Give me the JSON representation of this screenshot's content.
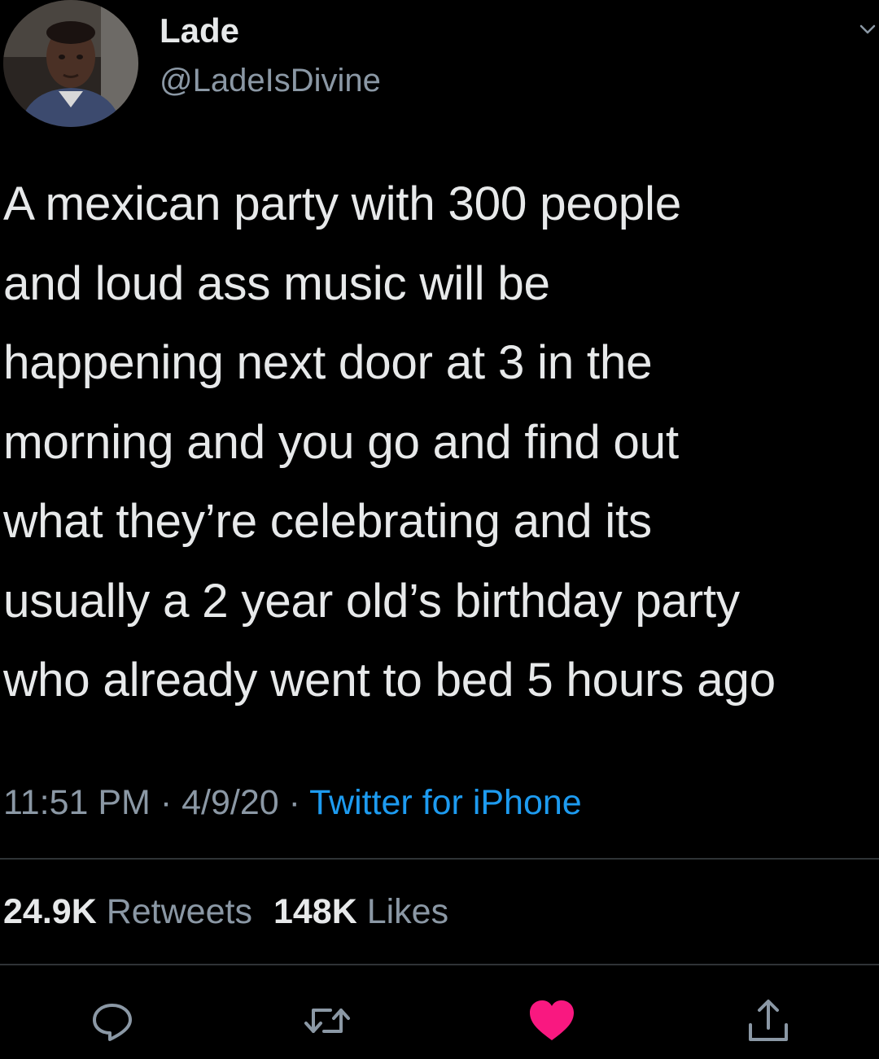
{
  "tweet": {
    "author": {
      "display_name": "Lade",
      "handle": "@LadeIsDivine",
      "avatar_icon": "profile-photo"
    },
    "text": "A mexican party with 300 people\nand loud ass music will be\nhappening next door at 3 in the\nmorning and you go and find out\nwhat they’re celebrating and its\nusually a 2 year old’s birthday party\nwho already went to bed 5 hours ago",
    "time": "11:51 PM",
    "separator": "·",
    "date": "4/9/20",
    "source": "Twitter for iPhone",
    "stats": {
      "retweets_count": "24.9K",
      "retweets_label": "Retweets",
      "likes_count": "148K",
      "likes_label": "Likes"
    },
    "actions": {
      "reply_icon": "reply-icon",
      "retweet_icon": "retweet-icon",
      "like_icon": "heart-icon",
      "share_icon": "share-icon",
      "liked": true
    }
  },
  "colors": {
    "background": "#000000",
    "primary_text": "#e7e9ea",
    "secondary_text": "#8b98a5",
    "link": "#1d9bf0",
    "like": "#f91880",
    "divider": "#2f3336"
  }
}
